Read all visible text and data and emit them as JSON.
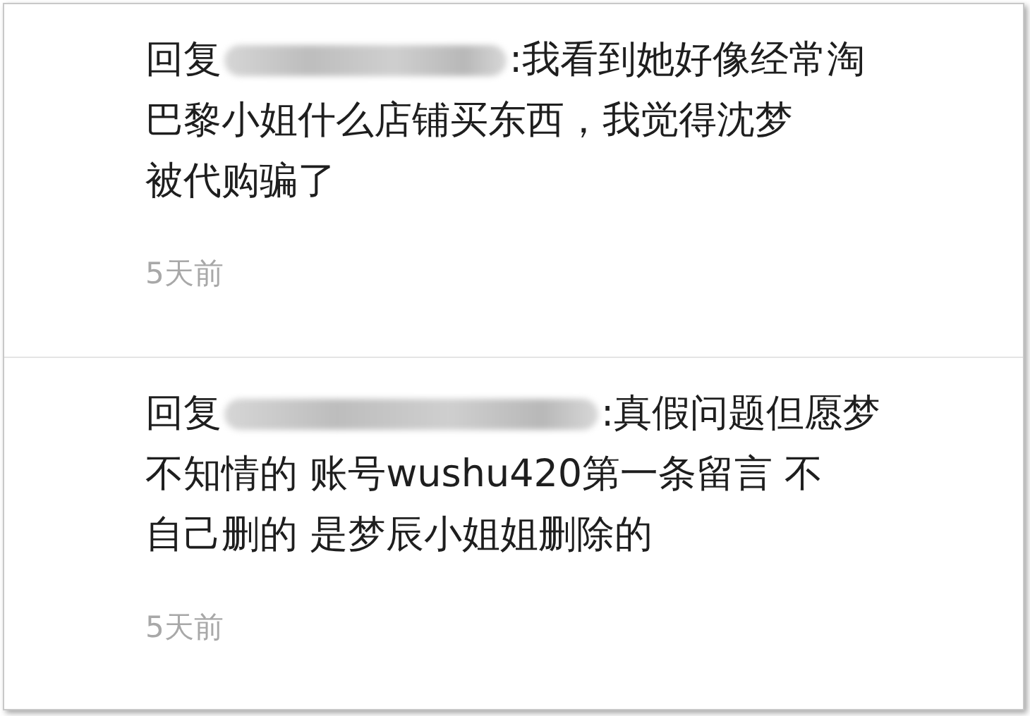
{
  "comments": [
    {
      "reply_label": "回复",
      "reply_text": ":我看到她好像经常淘",
      "lines": [
        "巴黎小姐什么店铺买东西，我觉得沈梦",
        "被代购骗了"
      ],
      "time": "5天前"
    },
    {
      "reply_label": "回复",
      "reply_text": ":真假问题但愿梦",
      "lines": [
        "不知情的 账号wushu420第一条留言 不",
        "自己删的 是梦辰小姐姐删除的"
      ],
      "time": "5天前"
    }
  ]
}
